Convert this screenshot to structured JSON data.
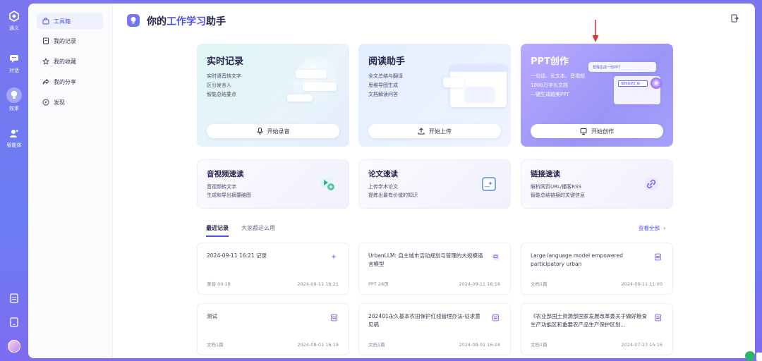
{
  "rail": {
    "logo_label": "通义",
    "items": [
      {
        "label": "对话",
        "icon": "chat-icon"
      },
      {
        "label": "效率",
        "icon": "bulb-icon"
      },
      {
        "label": "智能体",
        "icon": "agent-icon"
      }
    ],
    "bottom_icons": [
      "document-icon",
      "tablet-icon",
      "avatar"
    ]
  },
  "subnav": {
    "items": [
      {
        "label": "工具箱",
        "icon": "toolbox-icon"
      },
      {
        "label": "我的记录",
        "icon": "record-icon"
      },
      {
        "label": "我的收藏",
        "icon": "star-icon"
      },
      {
        "label": "我的分享",
        "icon": "share-icon"
      },
      {
        "label": "发现",
        "icon": "compass-icon"
      }
    ]
  },
  "header": {
    "title_prefix": "你的",
    "title_highlight": "工作学习",
    "title_suffix": "助手"
  },
  "feature_cards": [
    {
      "title": "实时记录",
      "lines": [
        "实时语音转文字",
        "区分发言人",
        "智能总结要点"
      ],
      "button": "开始录音",
      "icon": "mic-icon"
    },
    {
      "title": "阅读助手",
      "lines": [
        "全文总结与翻译",
        "思维导图生成",
        "文档解读问答"
      ],
      "button": "开始上传",
      "icon": "upload-icon"
    },
    {
      "title": "PPT创作",
      "lines": [
        "一句话、长文本、音视频",
        "1000万字长文档",
        "一键生成超美PPT"
      ],
      "button": "开始创作",
      "icon": "ppt-icon",
      "mock_text_1": "帮我生成一份PPT",
      "mock_text_2": "帮我总结汇报"
    }
  ],
  "tool_cards": [
    {
      "title": "音视频速读",
      "lines": [
        "音视频转文字",
        "生成和导出摘要脑图"
      ],
      "icon": "play-icon"
    },
    {
      "title": "论文速读",
      "lines": [
        "上传学术论文",
        "提炼出最有价值的知识"
      ],
      "icon": "paper-icon"
    },
    {
      "title": "链接速读",
      "lines": [
        "解析网页URL/播客RSS",
        "智能总结链接的关键信息"
      ],
      "icon": "link-icon"
    }
  ],
  "tabs": [
    {
      "label": "最近记录",
      "active": true
    },
    {
      "label": "大家都这么用",
      "active": false
    }
  ],
  "view_all": "查看全部",
  "records": [
    {
      "title": "2024-09-11 16:21 记录",
      "meta": "录音 00:18",
      "time": "2024-09-11 16:21",
      "icon": "sparkle-icon"
    },
    {
      "title": "UrbanLLM: 自主城市活动规划与管理的大规模语言模型",
      "meta": "PPT 28页",
      "time": "2024-09-11 16:16",
      "icon": "ppt-icon"
    },
    {
      "title": "Large language model empowered participatory urban",
      "meta": "文档1篇",
      "time": "2024-09-11 11:00",
      "icon": "doc-icon"
    },
    {
      "title": "测试",
      "meta": "文档1篇",
      "time": "2024-08-01 16:18",
      "icon": "doc-icon"
    },
    {
      "title": "202401永久基本农田保护红线管理办法-征求意见稿",
      "meta": "文档1篇",
      "time": "2024-08-01 16:14",
      "icon": "doc-icon"
    },
    {
      "title": "《农业部国土资源部国家发展改革委关于做好粮食生产功能区和重要农产品生产保护区划...",
      "meta": "文档1篇",
      "time": "2024-07-23 15:16",
      "icon": "doc-icon"
    }
  ],
  "colors": {
    "accent": "#4b4fe8",
    "ppt_card": "#a89ffb",
    "annotation_arrow": "#d9363e"
  }
}
